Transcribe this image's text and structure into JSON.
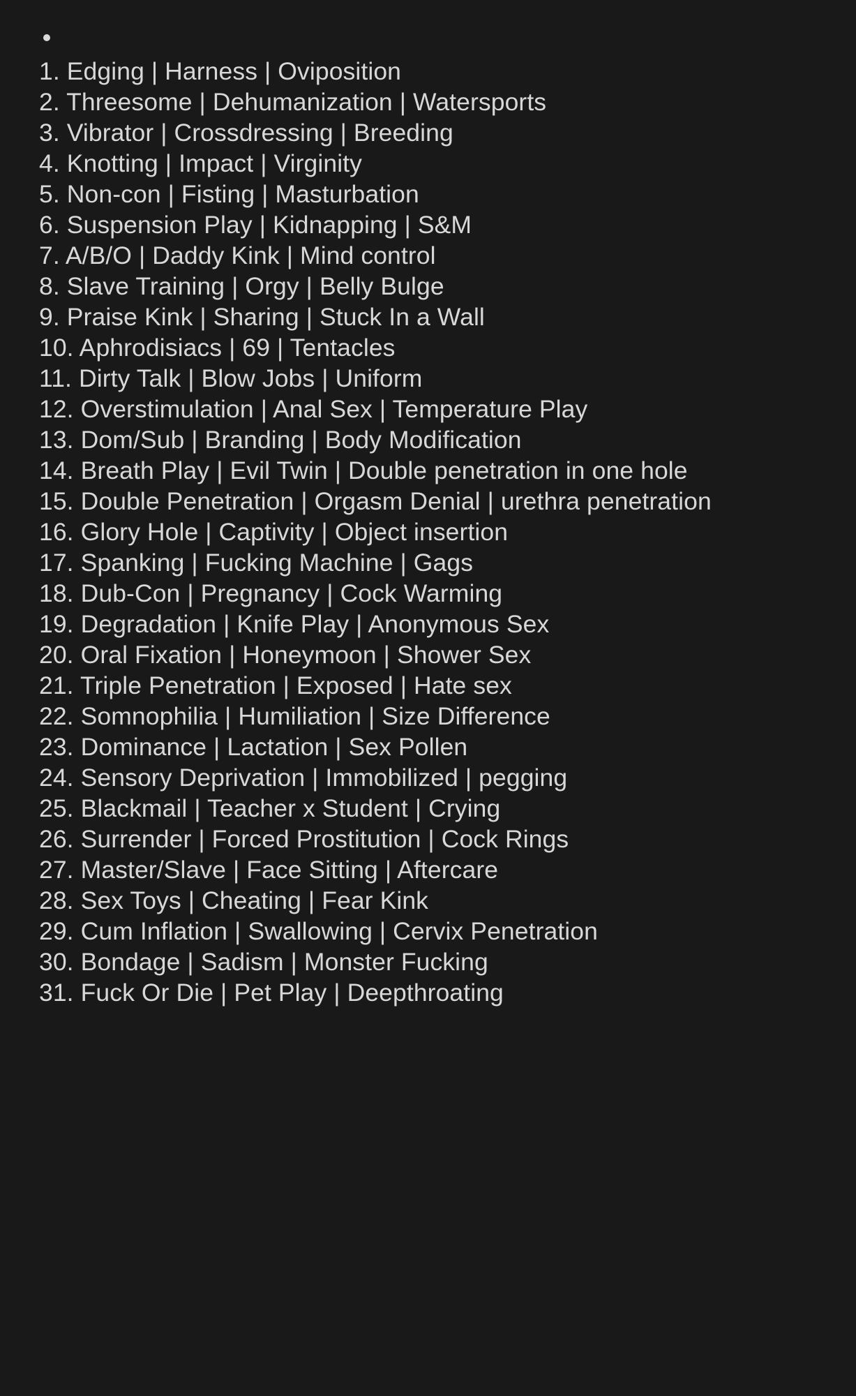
{
  "page": {
    "background_color": "#191919",
    "text_color": "#d8d8d8",
    "bullet_icon": "bullet-dot"
  },
  "list": {
    "items": [
      {
        "number": "1.",
        "text": "Edging | Harness | Oviposition"
      },
      {
        "number": "2.",
        "text": "Threesome | Dehumanization | Watersports"
      },
      {
        "number": "3.",
        "text": "Vibrator | Crossdressing | Breeding"
      },
      {
        "number": "4.",
        "text": "Knotting | Impact | Virginity"
      },
      {
        "number": "5.",
        "text": "Non-con | Fisting | Masturbation"
      },
      {
        "number": "6.",
        "text": "Suspension Play | Kidnapping | S&M"
      },
      {
        "number": "7.",
        "text": "A/B/O | Daddy Kink | Mind control"
      },
      {
        "number": "8.",
        "text": "Slave Training | Orgy | Belly Bulge"
      },
      {
        "number": "9.",
        "text": "Praise Kink | Sharing | Stuck In a Wall"
      },
      {
        "number": "10.",
        "text": "Aphrodisiacs | 69 | Tentacles"
      },
      {
        "number": "11.",
        "text": "Dirty Talk | Blow Jobs | Uniform"
      },
      {
        "number": "12.",
        "text": "Overstimulation | Anal Sex | Temperature Play"
      },
      {
        "number": "13.",
        "text": "Dom/Sub | Branding | Body Modification"
      },
      {
        "number": "14.",
        "text": "Breath Play | Evil Twin | Double penetration in one hole"
      },
      {
        "number": "15.",
        "text": "Double Penetration | Orgasm Denial | urethra penetration"
      },
      {
        "number": "16.",
        "text": "Glory Hole | Captivity | Object insertion"
      },
      {
        "number": "17.",
        "text": "Spanking | Fucking Machine | Gags"
      },
      {
        "number": "18.",
        "text": "Dub-Con | Pregnancy | Cock Warming"
      },
      {
        "number": "19.",
        "text": "Degradation | Knife Play | Anonymous Sex"
      },
      {
        "number": "20.",
        "text": "Oral Fixation | Honeymoon | Shower Sex"
      },
      {
        "number": "21.",
        "text": "Triple Penetration | Exposed | Hate sex"
      },
      {
        "number": "22.",
        "text": "Somnophilia | Humiliation | Size Difference"
      },
      {
        "number": "23.",
        "text": "Dominance | Lactation | Sex Pollen"
      },
      {
        "number": "24.",
        "text": "Sensory Deprivation | Immobilized | pegging"
      },
      {
        "number": "25.",
        "text": "Blackmail | Teacher x Student | Crying"
      },
      {
        "number": "26.",
        "text": "Surrender | Forced Prostitution | Cock Rings"
      },
      {
        "number": "27.",
        "text": "Master/Slave | Face Sitting | Aftercare"
      },
      {
        "number": "28.",
        "text": "Sex Toys | Cheating | Fear Kink"
      },
      {
        "number": "29.",
        "text": "Cum Inflation | Swallowing | Cervix Penetration"
      },
      {
        "number": "30.",
        "text": "Bondage | Sadism | Monster Fucking"
      },
      {
        "number": "31.",
        "text": "Fuck Or Die | Pet Play | Deepthroating"
      }
    ]
  }
}
